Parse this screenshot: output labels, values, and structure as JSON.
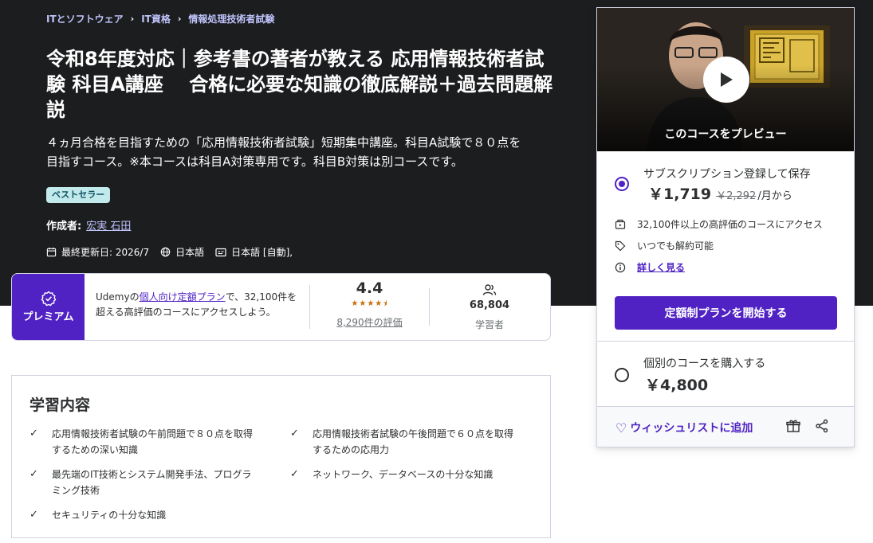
{
  "breadcrumb": [
    "ITとソフトウェア",
    "IT資格",
    "情報処理技術者試験"
  ],
  "course": {
    "title": "令和8年度対応｜参考書の著者が教える 応用情報技術者試験 科目A講座　 合格に必要な知識の徹底解説＋過去問題解説",
    "subtitle": "４ヵ月合格を目指すための「応用情報技術者試験」短期集中講座。科目A試験で８０点を目指すコース。※本コースは科目A対策専用です。科目B対策は別コースです。",
    "badge": "ベストセラー",
    "author_label": "作成者:",
    "author_name": "宏実 石田",
    "updated": "最終更新日: 2026/7",
    "language": "日本語",
    "captions": "日本語 [自動],"
  },
  "premium": {
    "label": "プレミアム",
    "text_before": "Udemyの",
    "link": "個人向け定額プラン",
    "text_after": "で、32,100件を超える高評価のコースにアクセスしよう。",
    "rating": "4.4",
    "rating_value": 4.4,
    "rating_count": "8,290件の評価",
    "learners": "68,804",
    "learners_label": "学習者"
  },
  "learn": {
    "heading": "学習内容",
    "items": [
      "応用情報技術者試験の午前問題で８０点を取得するための深い知識",
      "応用情報技術者試験の午後問題で６０点を取得するための応用力",
      "最先端のIT技術とシステム開発手法、プログラミング技術",
      "ネットワーク、データベースの十分な知識",
      "セキュリティの十分な知識"
    ]
  },
  "sidebar": {
    "preview_label": "このコースをプレビュー",
    "subscription": {
      "title": "サブスクリプション登録して保存",
      "price": "￥1,719",
      "old_price": "￥2,292",
      "unit": "/月から"
    },
    "features": [
      "32,100件以上の高評価のコースにアクセス",
      "いつでも解約可能",
      "詳しく見る"
    ],
    "cta": "定額制プランを開始する",
    "individual": {
      "title": "個別のコースを購入する",
      "price": "￥4,800"
    },
    "wishlist": "ウィッシュリストに追加"
  },
  "colors": {
    "hero_bg": "#1c1d1f",
    "accent": "#5022c3",
    "link_light": "#c0c4fc",
    "star": "#c4710d"
  }
}
